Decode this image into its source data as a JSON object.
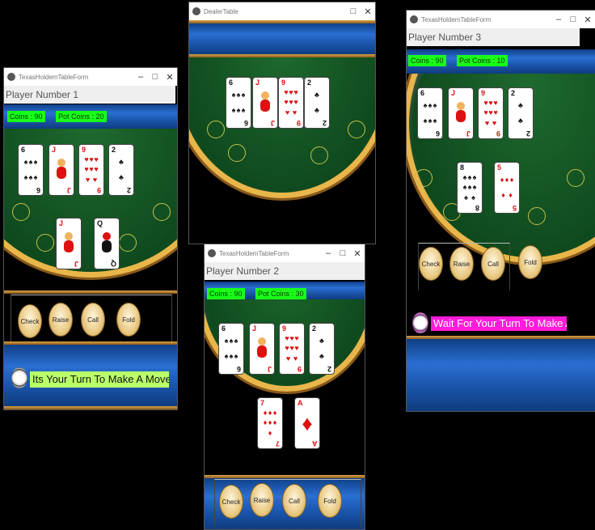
{
  "windows": {
    "w1": {
      "title": "TexasHoldemTableForm",
      "player_label": "Player Number 1",
      "coins": "Coins : 90",
      "pot": "Pot Coins : 20",
      "buttons": [
        "Check",
        "Raise",
        "Call",
        "Fold"
      ],
      "message": "Its Your Turn To Make A Move"
    },
    "w2": {
      "title": "DealerTable"
    },
    "w3": {
      "title": "TexasHoldemTableForm",
      "player_label": "Player Number 2",
      "coins": "Coins : 90",
      "pot": "Pot Coins : 30",
      "buttons": [
        "Check",
        "Raise",
        "Call",
        "Fold"
      ]
    },
    "w4": {
      "title": "TexasHoldemTableForm",
      "player_label": "Player Number 3",
      "coins": "Coins : 90",
      "pot": "Pot Coins : 10",
      "buttons": [
        "Check",
        "Raise",
        "Call",
        "Fold"
      ],
      "message": "Wait For Your Turn To Make A"
    }
  },
  "window_controls": {
    "minimize": "–",
    "maximize": "□",
    "close": "✕"
  },
  "community_cards": [
    "6♠",
    "J♥",
    "9♥",
    "2♣"
  ],
  "hands": {
    "player1": [
      "J♥",
      "Q♠"
    ],
    "player2": [
      "7♦",
      "A♦"
    ],
    "player3": [
      "8♠",
      "5♦"
    ]
  },
  "colors": {
    "felt": "#0f4a1e",
    "rail": "#e8b64a",
    "coins_bg": "#19ff19",
    "turn_bg": "#b9ff6a",
    "wait_bg": "#ff1bd8",
    "band_blue": "#1b55ad"
  }
}
